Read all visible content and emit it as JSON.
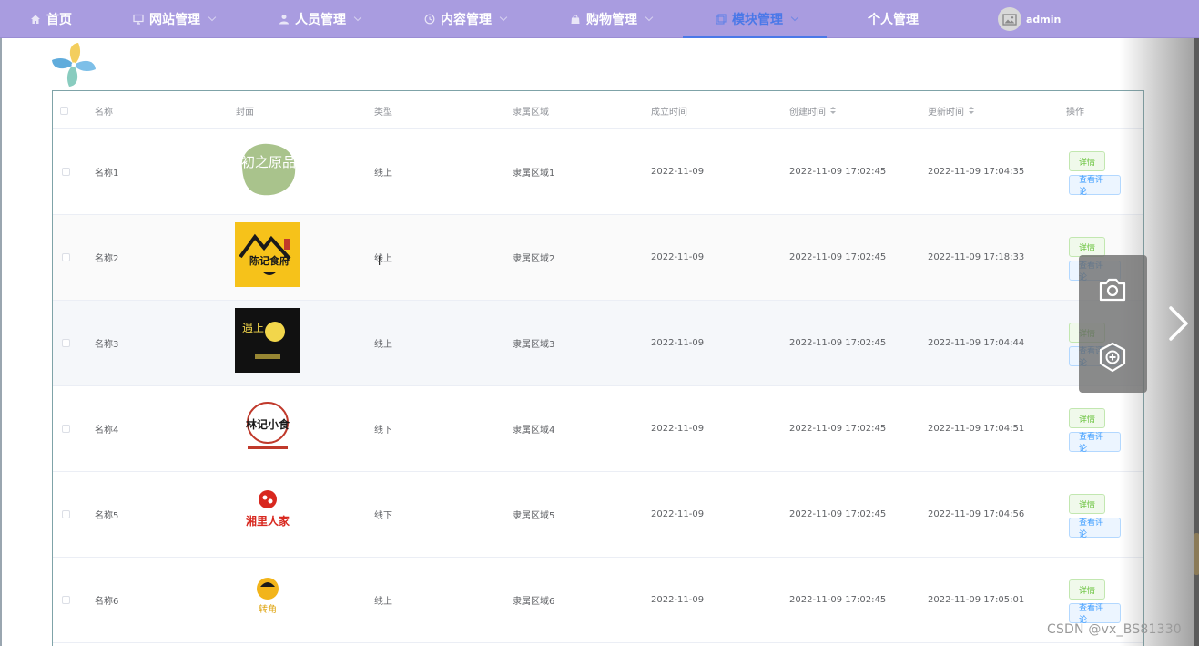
{
  "nav": {
    "items": [
      {
        "label": "首页",
        "icon": "home-icon"
      },
      {
        "label": "网站管理",
        "icon": "monitor-icon"
      },
      {
        "label": "人员管理",
        "icon": "user-icon"
      },
      {
        "label": "内容管理",
        "icon": "clock-icon"
      },
      {
        "label": "购物管理",
        "icon": "bag-icon"
      },
      {
        "label": "模块管理",
        "icon": "copy-icon",
        "active": true
      },
      {
        "label": "个人管理",
        "icon": ""
      }
    ],
    "user": {
      "name": "admin",
      "icon": "image-icon"
    },
    "active_color": "#4a78e8",
    "bar_color": "#a99ce0"
  },
  "table": {
    "headers": {
      "name": "名称",
      "cover": "封面",
      "type": "类型",
      "region": "隶属区域",
      "founded": "成立时间",
      "created": "创建时间",
      "updated": "更新时间",
      "actions": "操作"
    },
    "rows": [
      {
        "name": "名称1",
        "cover_text": "初之原品",
        "type": "线上",
        "region": "隶属区域1",
        "founded": "2022-11-09",
        "created": "2022-11-09 17:02:45",
        "updated": "2022-11-09 17:04:35",
        "detail": "详情",
        "comments": "查看评论"
      },
      {
        "name": "名称2",
        "cover_text": "陈记食府",
        "type": "线上",
        "region": "隶属区域2",
        "founded": "2022-11-09",
        "created": "2022-11-09 17:02:45",
        "updated": "2022-11-09 17:18:33",
        "detail": "详情",
        "comments": "查看评论"
      },
      {
        "name": "名称3",
        "cover_text": "遇上",
        "type": "线上",
        "region": "隶属区域3",
        "founded": "2022-11-09",
        "created": "2022-11-09 17:02:45",
        "updated": "2022-11-09 17:04:44",
        "detail": "详情",
        "comments": "查看评论"
      },
      {
        "name": "名称4",
        "cover_text": "林记小食",
        "type": "线下",
        "region": "隶属区域4",
        "founded": "2022-11-09",
        "created": "2022-11-09 17:02:45",
        "updated": "2022-11-09 17:04:51",
        "detail": "详情",
        "comments": "查看评论"
      },
      {
        "name": "名称5",
        "cover_text": "湘里人家",
        "type": "线下",
        "region": "隶属区域5",
        "founded": "2022-11-09",
        "created": "2022-11-09 17:02:45",
        "updated": "2022-11-09 17:04:56",
        "detail": "详情",
        "comments": "查看评论"
      },
      {
        "name": "名称6",
        "cover_text": "转角",
        "type": "线上",
        "region": "隶属区域6",
        "founded": "2022-11-09",
        "created": "2022-11-09 17:02:45",
        "updated": "2022-11-09 17:05:01",
        "detail": "详情",
        "comments": "查看评论"
      }
    ]
  },
  "overlay": {
    "watermark": "CSDN @vx_BS81330",
    "icons": [
      "camera-icon",
      "add-shield-icon",
      "chevron-right-icon"
    ]
  }
}
